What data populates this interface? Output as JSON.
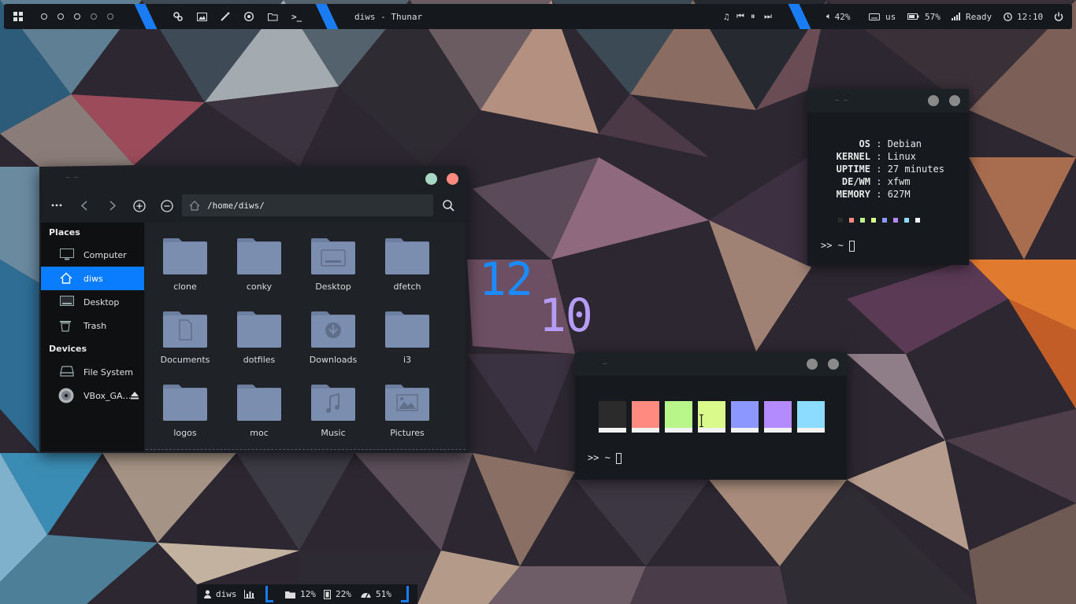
{
  "colors": {
    "accent_blue": "#1a7cf2",
    "selection_blue": "#0a7dff",
    "clock_hour": "#1a8cff",
    "clock_minute": "#b49cf7",
    "folder": "#7b8eb0",
    "close_button": "#ff8b80",
    "maximize_button": "#a8d8c4",
    "terminal_button": "#8a8a8a"
  },
  "top_panel": {
    "menu_icon": "grid-menu-icon",
    "workspaces": [
      "ws1",
      "ws2",
      "ws3",
      "ws4",
      "ws5"
    ],
    "launchers": [
      "settings-icon",
      "image-viewer-icon",
      "magic-wand-icon",
      "chrome-icon",
      "folder-open-icon",
      "terminal-icon"
    ],
    "window_title": "diws - Thunar",
    "media_icons": [
      "music-note-icon",
      "previous-track-icon",
      "pause-icon",
      "next-track-icon"
    ],
    "volume": {
      "icon": "volume-icon",
      "value": "42%"
    },
    "keyboard": {
      "icon": "keyboard-icon",
      "value": "us"
    },
    "battery": {
      "icon": "battery-icon",
      "value": "57%"
    },
    "network": {
      "icon": "signal-icon",
      "value": "Ready"
    },
    "clock": {
      "icon": "clock-icon",
      "value": "12:10"
    },
    "power_icon": "power-icon"
  },
  "thunar": {
    "path": "/home/diws/",
    "toolbar_icons": [
      "more-dots-icon",
      "back-icon",
      "forward-icon",
      "zoom-in-icon",
      "zoom-out-icon",
      "home-icon",
      "search-icon"
    ],
    "sidebar": {
      "places_heading": "Places",
      "places": [
        {
          "label": "Computer",
          "icon": "computer-icon"
        },
        {
          "label": "diws",
          "icon": "home-icon",
          "active": true
        },
        {
          "label": "Desktop",
          "icon": "desktop-icon"
        },
        {
          "label": "Trash",
          "icon": "trash-icon"
        }
      ],
      "devices_heading": "Devices",
      "devices": [
        {
          "label": "File System",
          "icon": "drive-icon"
        },
        {
          "label": "VBox_GA…",
          "icon": "disc-icon",
          "eject_icon": "eject-icon"
        }
      ]
    },
    "folders": [
      {
        "label": "clone",
        "emblem": ""
      },
      {
        "label": "conky",
        "emblem": ""
      },
      {
        "label": "Desktop",
        "emblem": "desktop"
      },
      {
        "label": "dfetch",
        "emblem": ""
      },
      {
        "label": "Documents",
        "emblem": "document"
      },
      {
        "label": "dotfiles",
        "emblem": ""
      },
      {
        "label": "Downloads",
        "emblem": "download"
      },
      {
        "label": "i3",
        "emblem": ""
      },
      {
        "label": "logos",
        "emblem": ""
      },
      {
        "label": "moc",
        "emblem": ""
      },
      {
        "label": "Music",
        "emblem": "music"
      },
      {
        "label": "Pictures",
        "emblem": "picture"
      }
    ]
  },
  "desktop_clock": {
    "hour": "12",
    "minute": "10"
  },
  "fetch_terminal": {
    "lines": [
      {
        "key": "OS",
        "value": "Debian"
      },
      {
        "key": "KERNEL",
        "value": "Linux"
      },
      {
        "key": "UPTIME",
        "value": "27 minutes"
      },
      {
        "key": "DE/WM",
        "value": "xfwm"
      },
      {
        "key": "MEMORY",
        "value": "627M"
      }
    ],
    "palette": [
      "#2b2b2b",
      "#ff8b80",
      "#b8f58a",
      "#dbfa8c",
      "#8c97ff",
      "#b48aff",
      "#8cdcff",
      "#f2f2f2"
    ],
    "prompt": ">> ~"
  },
  "colors_terminal": {
    "swatches": [
      "#2b2b2b",
      "#ff8b80",
      "#b8f58a",
      "#dbfa8c",
      "#8c97ff",
      "#b48aff",
      "#8cdcff"
    ],
    "prompt": ">> ~"
  },
  "bottom_panel": {
    "user": {
      "icon": "user-icon",
      "value": "diws"
    },
    "chart_icon": "bar-chart-icon",
    "disk": {
      "icon": "folder-icon",
      "value": "12%"
    },
    "memory": {
      "icon": "memory-icon",
      "value": "22%"
    },
    "cpu": {
      "icon": "gauge-icon",
      "value": "51%"
    }
  }
}
